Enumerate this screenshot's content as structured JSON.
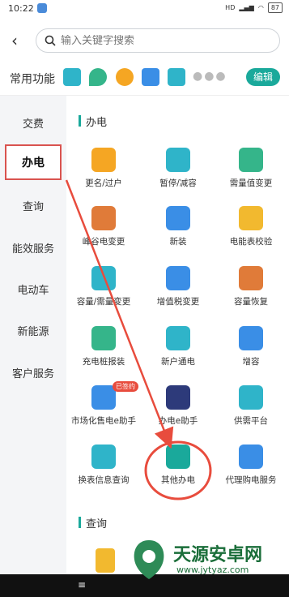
{
  "status": {
    "time": "10:22",
    "signal": "HD",
    "battery": "87"
  },
  "search": {
    "placeholder": "输入关键字搜索"
  },
  "common": {
    "label": "常用功能",
    "edit": "编辑"
  },
  "sidebar": {
    "items": [
      "交费",
      "办电",
      "查询",
      "能效服务",
      "电动车",
      "新能源",
      "客户服务"
    ],
    "active": "办电"
  },
  "sections": {
    "bandian": "办电",
    "chaxun": "查询"
  },
  "grid": [
    {
      "label": "更名/过户",
      "color": "#f5a623"
    },
    {
      "label": "暂停/减容",
      "color": "#2fb4c9"
    },
    {
      "label": "需量值变更",
      "color": "#35b58a"
    },
    {
      "label": "峰谷电变更",
      "color": "#e07b39"
    },
    {
      "label": "新装",
      "color": "#3a8ee6"
    },
    {
      "label": "电能表校验",
      "color": "#f2b92f"
    },
    {
      "label": "容量/需量变更",
      "color": "#2fb4c9"
    },
    {
      "label": "增值税变更",
      "color": "#3a8ee6"
    },
    {
      "label": "容量恢复",
      "color": "#e07b39"
    },
    {
      "label": "充电桩报装",
      "color": "#35b58a"
    },
    {
      "label": "新户通电",
      "color": "#2fb4c9"
    },
    {
      "label": "增容",
      "color": "#3a8ee6"
    },
    {
      "label": "市场化售电e助手",
      "color": "#3a8ee6",
      "badge": "已签约"
    },
    {
      "label": "办电e助手",
      "color": "#2d3a7a"
    },
    {
      "label": "供需平台",
      "color": "#2fb4c9"
    },
    {
      "label": "换表信息查询",
      "color": "#2fb4c9"
    },
    {
      "label": "其他办电",
      "color": "#1aa99b"
    },
    {
      "label": "代理购电服务",
      "color": "#3a8ee6"
    }
  ],
  "nav": {
    "menu": "≡"
  },
  "watermark": {
    "title": "天源安卓网",
    "url": "www.jytyaz.com"
  },
  "colors": {
    "accent": "#1aa99b",
    "highlight": "#d9534f"
  }
}
